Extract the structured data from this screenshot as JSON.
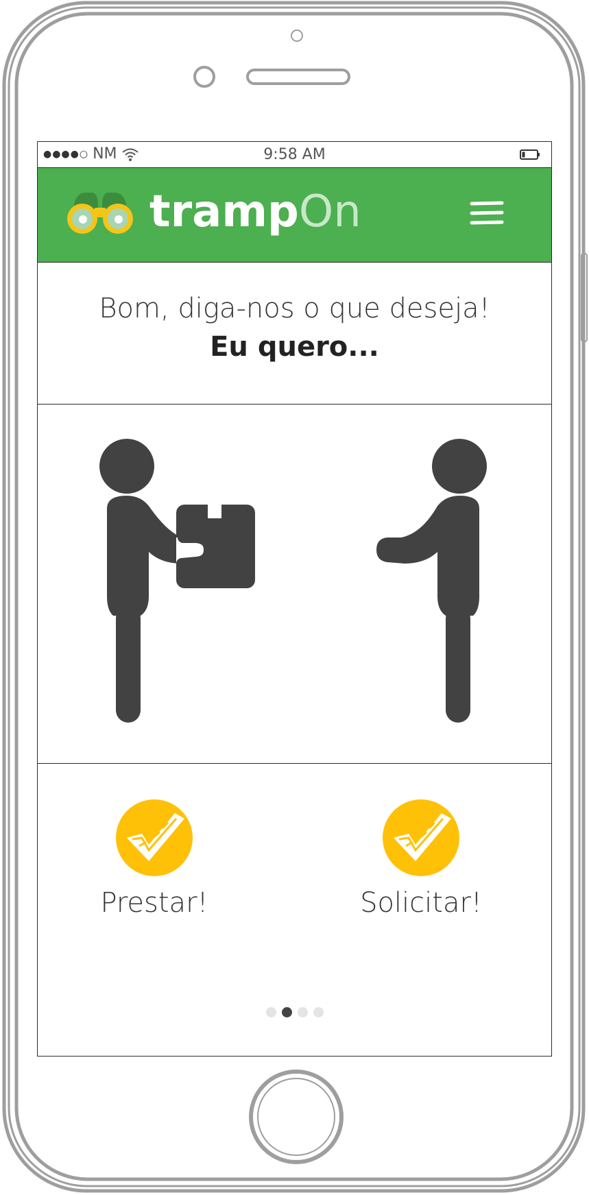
{
  "status_bar": {
    "signal": "●●●●○",
    "carrier": "NM",
    "time": "9:58 AM"
  },
  "header": {
    "brand_primary": "tramp",
    "brand_secondary": "On",
    "colors": {
      "bar": "#4caf50",
      "logo_accent": "#f5c518"
    }
  },
  "prompt": {
    "title": "Bom, diga-nos o que deseja!",
    "subtitle": "Eu quero..."
  },
  "options": [
    {
      "label": "Prestar!",
      "icon": "checkmark-icon"
    },
    {
      "label": "Solicitar!",
      "icon": "checkmark-icon"
    }
  ],
  "pager": {
    "count": 4,
    "active_index": 1
  },
  "colors": {
    "check_circle": "#ffc107",
    "figure": "#424242"
  }
}
